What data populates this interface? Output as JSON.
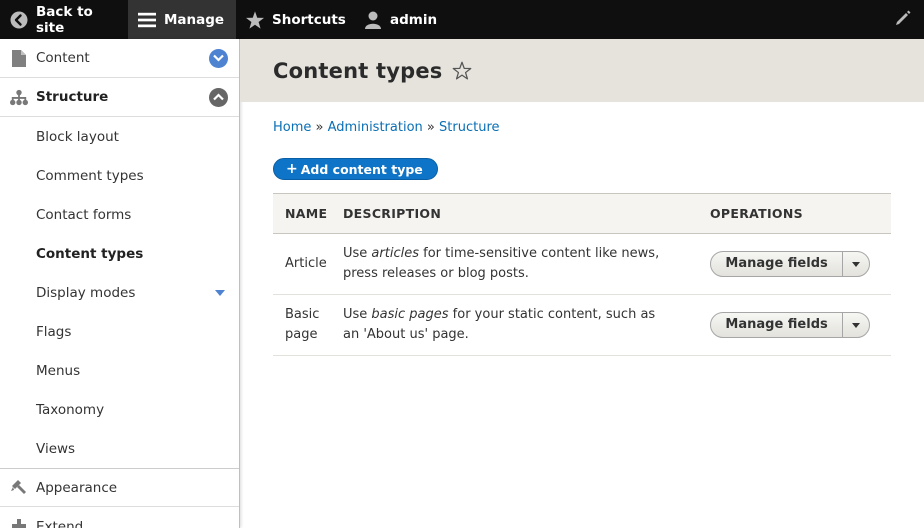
{
  "toolbar": {
    "back_label": "Back to site",
    "manage_label": "Manage",
    "shortcuts_label": "Shortcuts",
    "admin_label": "admin"
  },
  "sidebar": {
    "content_label": "Content",
    "structure_label": "Structure",
    "structure_items": [
      {
        "label": "Block layout"
      },
      {
        "label": "Comment types"
      },
      {
        "label": "Contact forms"
      },
      {
        "label": "Content types"
      },
      {
        "label": "Display modes"
      },
      {
        "label": "Flags"
      },
      {
        "label": "Menus"
      },
      {
        "label": "Taxonomy"
      },
      {
        "label": "Views"
      }
    ],
    "appearance_label": "Appearance",
    "extend_label": "Extend"
  },
  "page": {
    "title": "Content types",
    "breadcrumb": [
      "Home",
      "Administration",
      "Structure"
    ],
    "breadcrumb_sep": "»",
    "add_button": "Add content type"
  },
  "table": {
    "headers": {
      "name": "NAME",
      "description": "DESCRIPTION",
      "operations": "OPERATIONS"
    },
    "rows": [
      {
        "name": "Article",
        "desc_pre": "Use ",
        "desc_em": "articles",
        "desc_post": " for time-sensitive content like news, press releases or blog posts.",
        "op_label": "Manage fields"
      },
      {
        "name": "Basic page",
        "desc_pre": "Use ",
        "desc_em": "basic pages",
        "desc_post": " for your static content, such as an 'About us' page.",
        "op_label": "Manage fields"
      }
    ]
  },
  "colors": {
    "toolbar_bg": "#0f0f0f",
    "link": "#0a6fb4",
    "primary_button": "#0e74c7",
    "header_bg": "#e5e3dc",
    "toggle_blue": "#4e83d2"
  }
}
